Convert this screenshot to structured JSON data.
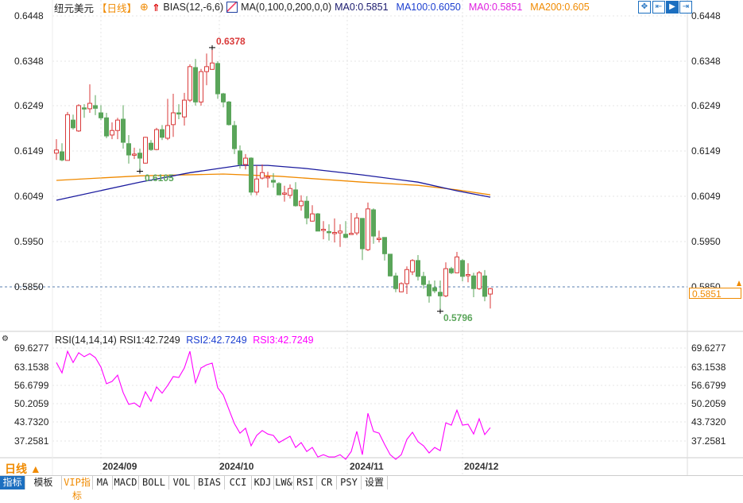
{
  "header": {
    "symbol": "纽元美元",
    "period": "【日线】",
    "bias": "BIAS(12,-6,6)",
    "ma_setting": "MA(0,100,0,200,0,0)",
    "ma_values": [
      {
        "label": "MA0:0.5851",
        "color": "#1a1a6e"
      },
      {
        "label": "MA100:0.6050",
        "color": "#1c3fd0"
      },
      {
        "label": "MA0:0.5851",
        "color": "#e020e0"
      },
      {
        "label": "MA200:0.605",
        "color": "#f08a00"
      }
    ]
  },
  "top_right_buttons": [
    "crosshair",
    "zoom-in",
    "zoom-out",
    "scroll-end"
  ],
  "price_axis": [
    "0.6448",
    "0.6348",
    "0.6249",
    "0.6149",
    "0.6049",
    "0.5950",
    "0.5850"
  ],
  "current_price": "0.5851",
  "annotations": {
    "high": "0.6378",
    "low1": "0.6105",
    "low2": "0.5796"
  },
  "rsi": {
    "title": "RSI(14,14,14)",
    "rsi1": "RSI1:42.7249",
    "rsi2": "RSI2:42.7249",
    "rsi3": "RSI3:42.7249",
    "axis": [
      "69.6277",
      "63.1538",
      "56.6799",
      "50.2059",
      "43.7320",
      "37.2581"
    ]
  },
  "x_axis": [
    "2024/09",
    "2024/10",
    "2024/11",
    "2024/12"
  ],
  "period_selector": "日线 ▲",
  "toolbar": [
    "指标",
    "模板",
    "VIP指标",
    "MA",
    "MACD",
    "BOLL",
    "VOL",
    "BIAS",
    "CCI",
    "KDJ",
    "LW&",
    "RSI",
    "CR",
    "PSY",
    "设置"
  ],
  "colors": {
    "up": "#d93a3a",
    "down": "#5aa55a",
    "ma100": "#1a1a9e",
    "ma200": "#f08a00",
    "rsi": "#ff00ff"
  },
  "chart_data": [
    {
      "type": "candlestick",
      "title": "纽元美元 日线",
      "ylim": [
        0.5796,
        0.6448
      ],
      "ohlc": [
        [
          0.6145,
          0.6152,
          0.6176,
          0.613
        ],
        [
          0.6148,
          0.613,
          0.6167,
          0.6127
        ],
        [
          0.6129,
          0.623,
          0.6236,
          0.6129
        ],
        [
          0.6218,
          0.6201,
          0.623,
          0.6197
        ],
        [
          0.6194,
          0.625,
          0.6253,
          0.6192
        ],
        [
          0.6245,
          0.6244,
          0.6253,
          0.6223
        ],
        [
          0.6243,
          0.6255,
          0.6297,
          0.6234
        ],
        [
          0.625,
          0.6244,
          0.6273,
          0.6229
        ],
        [
          0.6234,
          0.6223,
          0.6251,
          0.6218
        ],
        [
          0.6223,
          0.6183,
          0.6234,
          0.6178
        ],
        [
          0.6185,
          0.6195,
          0.6213,
          0.6176
        ],
        [
          0.6195,
          0.6218,
          0.6223,
          0.6176
        ],
        [
          0.622,
          0.6169,
          0.6251,
          0.6155
        ],
        [
          0.6166,
          0.6141,
          0.6185,
          0.6122
        ],
        [
          0.6142,
          0.6143,
          0.6157,
          0.6132
        ],
        [
          0.6145,
          0.6134,
          0.6155,
          0.6105
        ],
        [
          0.6123,
          0.618,
          0.6181,
          0.6122
        ],
        [
          0.6167,
          0.6153,
          0.6174,
          0.615
        ],
        [
          0.6153,
          0.6197,
          0.6201,
          0.6152
        ],
        [
          0.6197,
          0.618,
          0.6207,
          0.6174
        ],
        [
          0.6178,
          0.6206,
          0.6265,
          0.6174
        ],
        [
          0.6208,
          0.6234,
          0.6276,
          0.6181
        ],
        [
          0.6234,
          0.6232,
          0.6253,
          0.622
        ],
        [
          0.6225,
          0.6262,
          0.6278,
          0.6206
        ],
        [
          0.6262,
          0.6336,
          0.6341,
          0.6258
        ],
        [
          0.6334,
          0.6258,
          0.6353,
          0.625
        ],
        [
          0.6258,
          0.6325,
          0.6331,
          0.625
        ],
        [
          0.6325,
          0.6336,
          0.6365,
          0.6295
        ],
        [
          0.633,
          0.6344,
          0.6378,
          0.6329
        ],
        [
          0.6343,
          0.6276,
          0.6348,
          0.6265
        ],
        [
          0.6276,
          0.6258,
          0.6278,
          0.6246
        ],
        [
          0.6258,
          0.6208,
          0.626,
          0.6206
        ],
        [
          0.6206,
          0.6155,
          0.6216,
          0.6143
        ],
        [
          0.615,
          0.612,
          0.6162,
          0.6111
        ],
        [
          0.612,
          0.6134,
          0.6143,
          0.6109
        ],
        [
          0.6134,
          0.6059,
          0.6136,
          0.6052
        ],
        [
          0.6059,
          0.6088,
          0.6118,
          0.6052
        ],
        [
          0.609,
          0.6102,
          0.612,
          0.6087
        ],
        [
          0.6092,
          0.6093,
          0.6104,
          0.6069
        ],
        [
          0.6085,
          0.6081,
          0.6101,
          0.6069
        ],
        [
          0.6078,
          0.6053,
          0.6081,
          0.6052
        ],
        [
          0.6056,
          0.6057,
          0.6073,
          0.6038
        ],
        [
          0.6052,
          0.6067,
          0.6076,
          0.6045
        ],
        [
          0.6064,
          0.6029,
          0.6081,
          0.6027
        ],
        [
          0.6029,
          0.6039,
          0.6052,
          0.6018
        ],
        [
          0.6039,
          0.6002,
          0.605,
          0.5988
        ],
        [
          0.5995,
          0.6011,
          0.603,
          0.5994
        ],
        [
          0.6011,
          0.5973,
          0.6013,
          0.5973
        ],
        [
          0.5976,
          0.5977,
          0.5995,
          0.5955
        ],
        [
          0.5972,
          0.5971,
          0.5988,
          0.5952
        ],
        [
          0.5969,
          0.597,
          0.6001,
          0.5948
        ],
        [
          0.5969,
          0.5973,
          0.5988,
          0.5938
        ],
        [
          0.5966,
          0.5959,
          0.5995,
          0.5957
        ],
        [
          0.5967,
          0.5968,
          0.6013,
          0.5966
        ],
        [
          0.5969,
          0.6002,
          0.6013,
          0.5964
        ],
        [
          0.6001,
          0.5934,
          0.6001,
          0.5909
        ],
        [
          0.5932,
          0.6022,
          0.6036,
          0.5929
        ],
        [
          0.602,
          0.5962,
          0.6023,
          0.5945
        ],
        [
          0.5956,
          0.5957,
          0.5974,
          0.5948
        ],
        [
          0.5959,
          0.5923,
          0.5959,
          0.5908
        ],
        [
          0.5922,
          0.5874,
          0.5922,
          0.5873
        ],
        [
          0.5874,
          0.5846,
          0.5881,
          0.5838
        ],
        [
          0.5839,
          0.5857,
          0.586,
          0.5838
        ],
        [
          0.5857,
          0.5888,
          0.5895,
          0.5834
        ],
        [
          0.5883,
          0.5908,
          0.5911,
          0.5876
        ],
        [
          0.5908,
          0.5873,
          0.592,
          0.5864
        ],
        [
          0.5873,
          0.5855,
          0.5883,
          0.5846
        ],
        [
          0.5855,
          0.583,
          0.5864,
          0.5815
        ],
        [
          0.5848,
          0.5841,
          0.5864,
          0.5836
        ],
        [
          0.5838,
          0.583,
          0.5864,
          0.5796
        ],
        [
          0.583,
          0.589,
          0.5904,
          0.5827
        ],
        [
          0.589,
          0.5881,
          0.5894,
          0.5878
        ],
        [
          0.5881,
          0.5916,
          0.5927,
          0.588
        ],
        [
          0.5908,
          0.5873,
          0.5911,
          0.5862
        ],
        [
          0.5876,
          0.5877,
          0.5902,
          0.586
        ],
        [
          0.5874,
          0.5846,
          0.5881,
          0.5827
        ],
        [
          0.5846,
          0.5881,
          0.5885,
          0.5843
        ],
        [
          0.5874,
          0.5829,
          0.5887,
          0.5818
        ],
        [
          0.5834,
          0.5846,
          0.5848,
          0.5802
        ]
      ],
      "ma100": [
        [
          0,
          0.6041
        ],
        [
          15,
          0.6081
        ],
        [
          24,
          0.6102
        ],
        [
          33,
          0.6118
        ],
        [
          38,
          0.6118
        ],
        [
          45,
          0.6111
        ],
        [
          55,
          0.6097
        ],
        [
          65,
          0.6081
        ],
        [
          72,
          0.6062
        ],
        [
          78,
          0.6048
        ]
      ],
      "ma200": [
        [
          0,
          0.6085
        ],
        [
          15,
          0.6095
        ],
        [
          30,
          0.6099
        ],
        [
          40,
          0.6094
        ],
        [
          55,
          0.6081
        ],
        [
          65,
          0.6074
        ],
        [
          72,
          0.6064
        ],
        [
          78,
          0.6053
        ]
      ],
      "high_index": 28,
      "low_indices": [
        15,
        69
      ]
    },
    {
      "type": "line",
      "title": "RSI(14,14,14)",
      "ylim": [
        30.9,
        69.6277
      ],
      "values": [
        64.6,
        61.0,
        68.5,
        64.6,
        68.0,
        66.6,
        67.7,
        66.3,
        63.0,
        57.2,
        58.0,
        60.2,
        54.1,
        50.0,
        50.5,
        49.1,
        54.4,
        51.1,
        56.1,
        53.9,
        56.6,
        59.7,
        59.4,
        62.7,
        68.5,
        57.5,
        62.7,
        63.8,
        64.4,
        55.8,
        53.3,
        48.3,
        43.3,
        40.0,
        41.7,
        35.6,
        39.2,
        40.9,
        39.7,
        39.2,
        36.7,
        37.8,
        38.9,
        35.0,
        36.7,
        33.6,
        35.0,
        31.7,
        32.5,
        31.7,
        31.7,
        32.5,
        30.9,
        33.6,
        40.6,
        32.5,
        46.9,
        40.6,
        40.0,
        36.1,
        32.5,
        30.9,
        32.5,
        37.8,
        40.3,
        37.0,
        35.6,
        33.1,
        35.0,
        33.9,
        43.6,
        42.8,
        48.0,
        42.8,
        43.1,
        39.7,
        45.0,
        39.5,
        41.9
      ]
    }
  ]
}
